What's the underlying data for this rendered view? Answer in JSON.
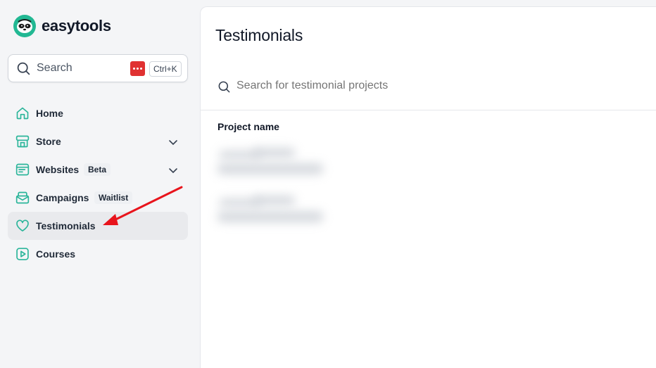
{
  "brand": {
    "name": "easytools"
  },
  "search": {
    "label": "Search",
    "shortcut": "Ctrl+K"
  },
  "nav": {
    "items": [
      {
        "label": "Home",
        "icon": "home-icon"
      },
      {
        "label": "Store",
        "icon": "store-icon",
        "expandable": true
      },
      {
        "label": "Websites",
        "icon": "website-icon",
        "badge": "Beta",
        "expandable": true
      },
      {
        "label": "Campaigns",
        "icon": "mail-icon",
        "badge": "Waitlist"
      },
      {
        "label": "Testimonials",
        "icon": "heart-icon",
        "active": true
      },
      {
        "label": "Courses",
        "icon": "play-icon"
      }
    ]
  },
  "main": {
    "title": "Testimonials",
    "search_placeholder": "Search for testimonial projects",
    "table": {
      "columns": [
        "Project name"
      ]
    }
  },
  "colors": {
    "accent": "#2bb59a",
    "active_bg": "#e9eaed",
    "annotation": "#e8141c"
  }
}
